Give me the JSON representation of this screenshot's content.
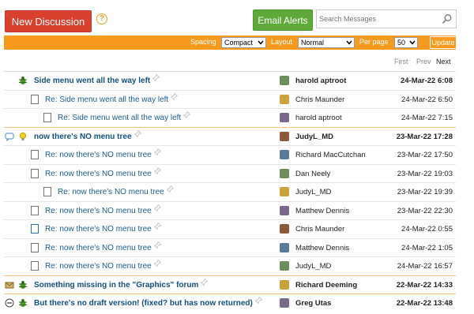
{
  "toolbar": {
    "new_discussion": "New Discussion",
    "help": "?",
    "email_alerts": "Email Alerts",
    "search_placeholder": "Search Messages"
  },
  "options": {
    "spacing_label": "Spacing",
    "spacing_value": "Compact",
    "layout_label": "Layout",
    "layout_value": "Normal",
    "perpage_label": "Per page",
    "perpage_value": "50",
    "update": "Update"
  },
  "pager": {
    "first": "First",
    "prev": "Prev",
    "next": "Next"
  },
  "colors": {
    "orange": "#f79a1e",
    "red": "#d9412e",
    "green": "#5fa83a",
    "link": "#1a5c8c"
  },
  "messages": [
    {
      "subject": "Side menu went all the way left",
      "author": "harold aptroot",
      "date": "24-Mar-22 6:08",
      "level": 0,
      "top": true,
      "icon": "bug-icon"
    },
    {
      "subject": "Re: Side menu went all the way left",
      "author": "Chris Maunder",
      "date": "24-Mar-22 6:50",
      "level": 1,
      "top": false,
      "icon": "doc-icon"
    },
    {
      "subject": "Re: Side menu went all the way left",
      "author": "harold aptroot",
      "date": "24-Mar-22 7:15",
      "level": 2,
      "top": false,
      "icon": "doc-icon"
    },
    {
      "subject": "now there's NO menu tree",
      "author": "JudyL_MD",
      "date": "23-Mar-22 17:28",
      "level": 0,
      "top": true,
      "icon": "idea-icon"
    },
    {
      "subject": "Re: now there's NO menu tree",
      "author": "Richard MacCutchan",
      "date": "23-Mar-22 17:50",
      "level": 1,
      "top": false,
      "icon": "doc-icon"
    },
    {
      "subject": "Re: now there's NO menu tree",
      "author": "Dan Neely",
      "date": "23-Mar-22 19:03",
      "level": 1,
      "top": false,
      "icon": "doc-icon"
    },
    {
      "subject": "Re: now there's NO menu tree",
      "author": "JudyL_MD",
      "date": "23-Mar-22 19:39",
      "level": 2,
      "top": false,
      "icon": "doc-icon"
    },
    {
      "subject": "Re: now there's NO menu tree",
      "author": "Matthew Dennis",
      "date": "23-Mar-22 22:30",
      "level": 1,
      "top": false,
      "icon": "doc-icon"
    },
    {
      "subject": "Re: now there's NO menu tree",
      "author": "Chris Maunder",
      "date": "24-Mar-22 0:55",
      "level": 1,
      "top": false,
      "icon": "checked-doc-icon"
    },
    {
      "subject": "Re: now there's NO menu tree",
      "author": "Matthew Dennis",
      "date": "24-Mar-22 1:05",
      "level": 1,
      "top": false,
      "icon": "doc-icon"
    },
    {
      "subject": "Re: now there's NO menu tree",
      "author": "JudyL_MD",
      "date": "24-Mar-22 16:57",
      "level": 1,
      "top": false,
      "icon": "doc-icon"
    },
    {
      "subject": "Something missing in the \"Graphics\" forum",
      "author": "Richard Deeming",
      "date": "22-Mar-22 14:33",
      "level": 0,
      "top": true,
      "icon": "bug-icon"
    },
    {
      "subject": "But there's no draft version! (fixed? but has now returned)",
      "author": "Greg Utas",
      "date": "22-Mar-22 13:48",
      "level": 0,
      "top": true,
      "icon": "bug-icon"
    }
  ]
}
